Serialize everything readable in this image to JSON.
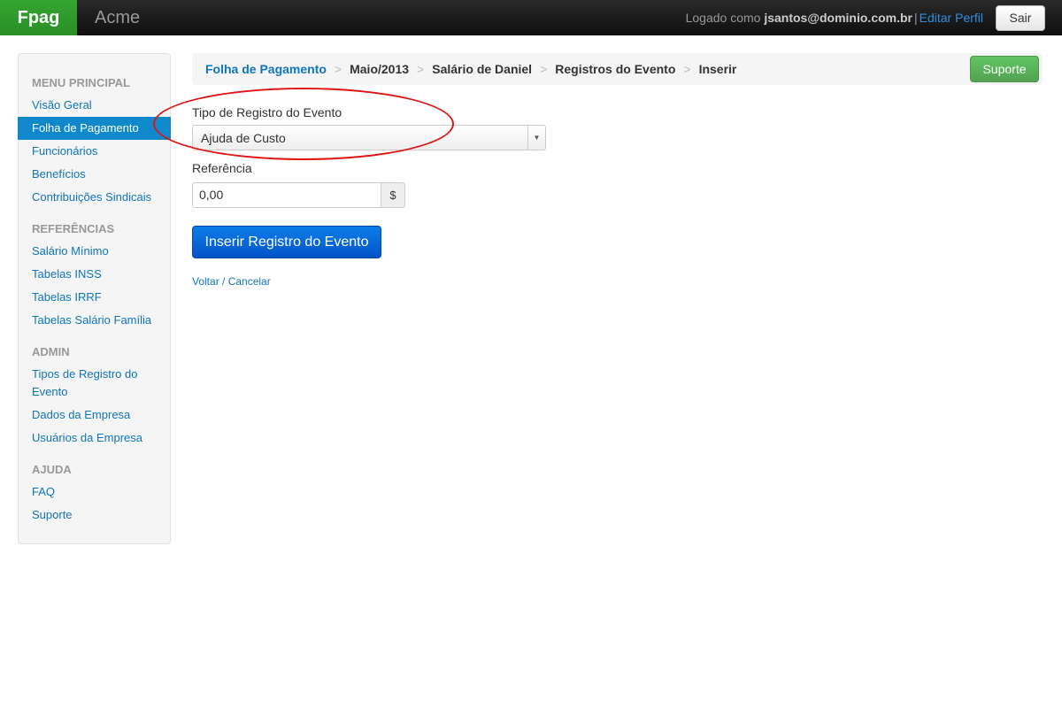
{
  "navbar": {
    "brand": "Fpag",
    "company": "Acme",
    "logged_prefix": "Logado como",
    "user": "jsantos@dominio.com.br",
    "separator": "|",
    "edit_profile": "Editar Perfil",
    "logout": "Sair"
  },
  "sidebar": {
    "sections": [
      {
        "header": "MENU PRINCIPAL"
      },
      {
        "header": "REFERÊNCIAS"
      },
      {
        "header": "ADMIN"
      },
      {
        "header": "AJUDA"
      }
    ],
    "items": [
      "Visão Geral",
      "Folha de Pagamento",
      "Funcionários",
      "Benefícios",
      "Contribuições Sindicais",
      "Salário Mínimo",
      "Tabelas INSS",
      "Tabelas IRRF",
      "Tabelas Salário Família",
      "Tipos de Registro do",
      "Evento",
      "Dados da Empresa",
      "Usuários da Empresa",
      "FAQ",
      "Suporte"
    ],
    "active_item": "Folha de Pagamento"
  },
  "breadcrumb": {
    "items": [
      "Folha de Pagamento",
      "Maio/2013",
      "Salário de Daniel",
      "Registros do Evento",
      "Inserir"
    ],
    "divider": ">",
    "support_button": "Suporte"
  },
  "form": {
    "event_type_label": "Tipo de Registro do Evento",
    "event_type_value": "Ajuda de Custo",
    "reference_label": "Referência",
    "reference_value": "0,00",
    "reference_addon": "$",
    "submit_label": "Inserir Registro do Evento",
    "cancel_link": "Voltar / Cancelar"
  },
  "colors": {
    "brand_green": "#34a52f",
    "link_blue": "#0f75bd",
    "active_blue": "#0f88cc",
    "primary_button": "#0b7ee8",
    "annotation_red": "#e01414"
  }
}
